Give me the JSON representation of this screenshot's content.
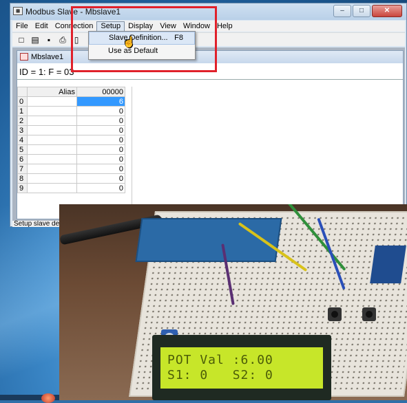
{
  "window": {
    "title": "Modbus Slave - Mbslave1",
    "app_icon_glyph": "▦",
    "controls": {
      "minimize": "–",
      "maximize": "□",
      "close": "✕"
    }
  },
  "menubar": {
    "items": [
      "File",
      "Edit",
      "Connection",
      "Setup",
      "Display",
      "View",
      "Window",
      "Help"
    ],
    "open_item": "Setup"
  },
  "toolbar": {
    "icons": [
      "new-document-icon",
      "open-folder-icon",
      "save-icon",
      "print-icon",
      "window-icon"
    ],
    "glyphs": [
      "□",
      "▤",
      "▪",
      "⎙",
      "▯"
    ]
  },
  "dropdown": {
    "items": [
      {
        "label": "Slave Definition...",
        "shortcut": "F8"
      },
      {
        "label": "Use as Default",
        "shortcut": ""
      }
    ],
    "highlighted_index": 0
  },
  "child_window": {
    "title": "Mbslave1",
    "status_line": "ID = 1: F = 03"
  },
  "register_table": {
    "headers": [
      "",
      "Alias",
      "00000"
    ],
    "rows": [
      {
        "row": "0",
        "alias": "",
        "value": "6"
      },
      {
        "row": "1",
        "alias": "",
        "value": "0"
      },
      {
        "row": "2",
        "alias": "",
        "value": "0"
      },
      {
        "row": "3",
        "alias": "",
        "value": "0"
      },
      {
        "row": "4",
        "alias": "",
        "value": "0"
      },
      {
        "row": "5",
        "alias": "",
        "value": "0"
      },
      {
        "row": "6",
        "alias": "",
        "value": "0"
      },
      {
        "row": "7",
        "alias": "",
        "value": "0"
      },
      {
        "row": "8",
        "alias": "",
        "value": "0"
      },
      {
        "row": "9",
        "alias": "",
        "value": "0"
      }
    ],
    "selected_row": 0
  },
  "statusbar": {
    "text": "Setup slave defi"
  },
  "photo": {
    "lcd_line1": "POT Val :6.00",
    "lcd_line2": "S1: 0   S2: 0"
  },
  "colors": {
    "annotation_box": "#e0202a",
    "selected_cell": "#3399ff",
    "lcd_background": "#c7e629"
  }
}
